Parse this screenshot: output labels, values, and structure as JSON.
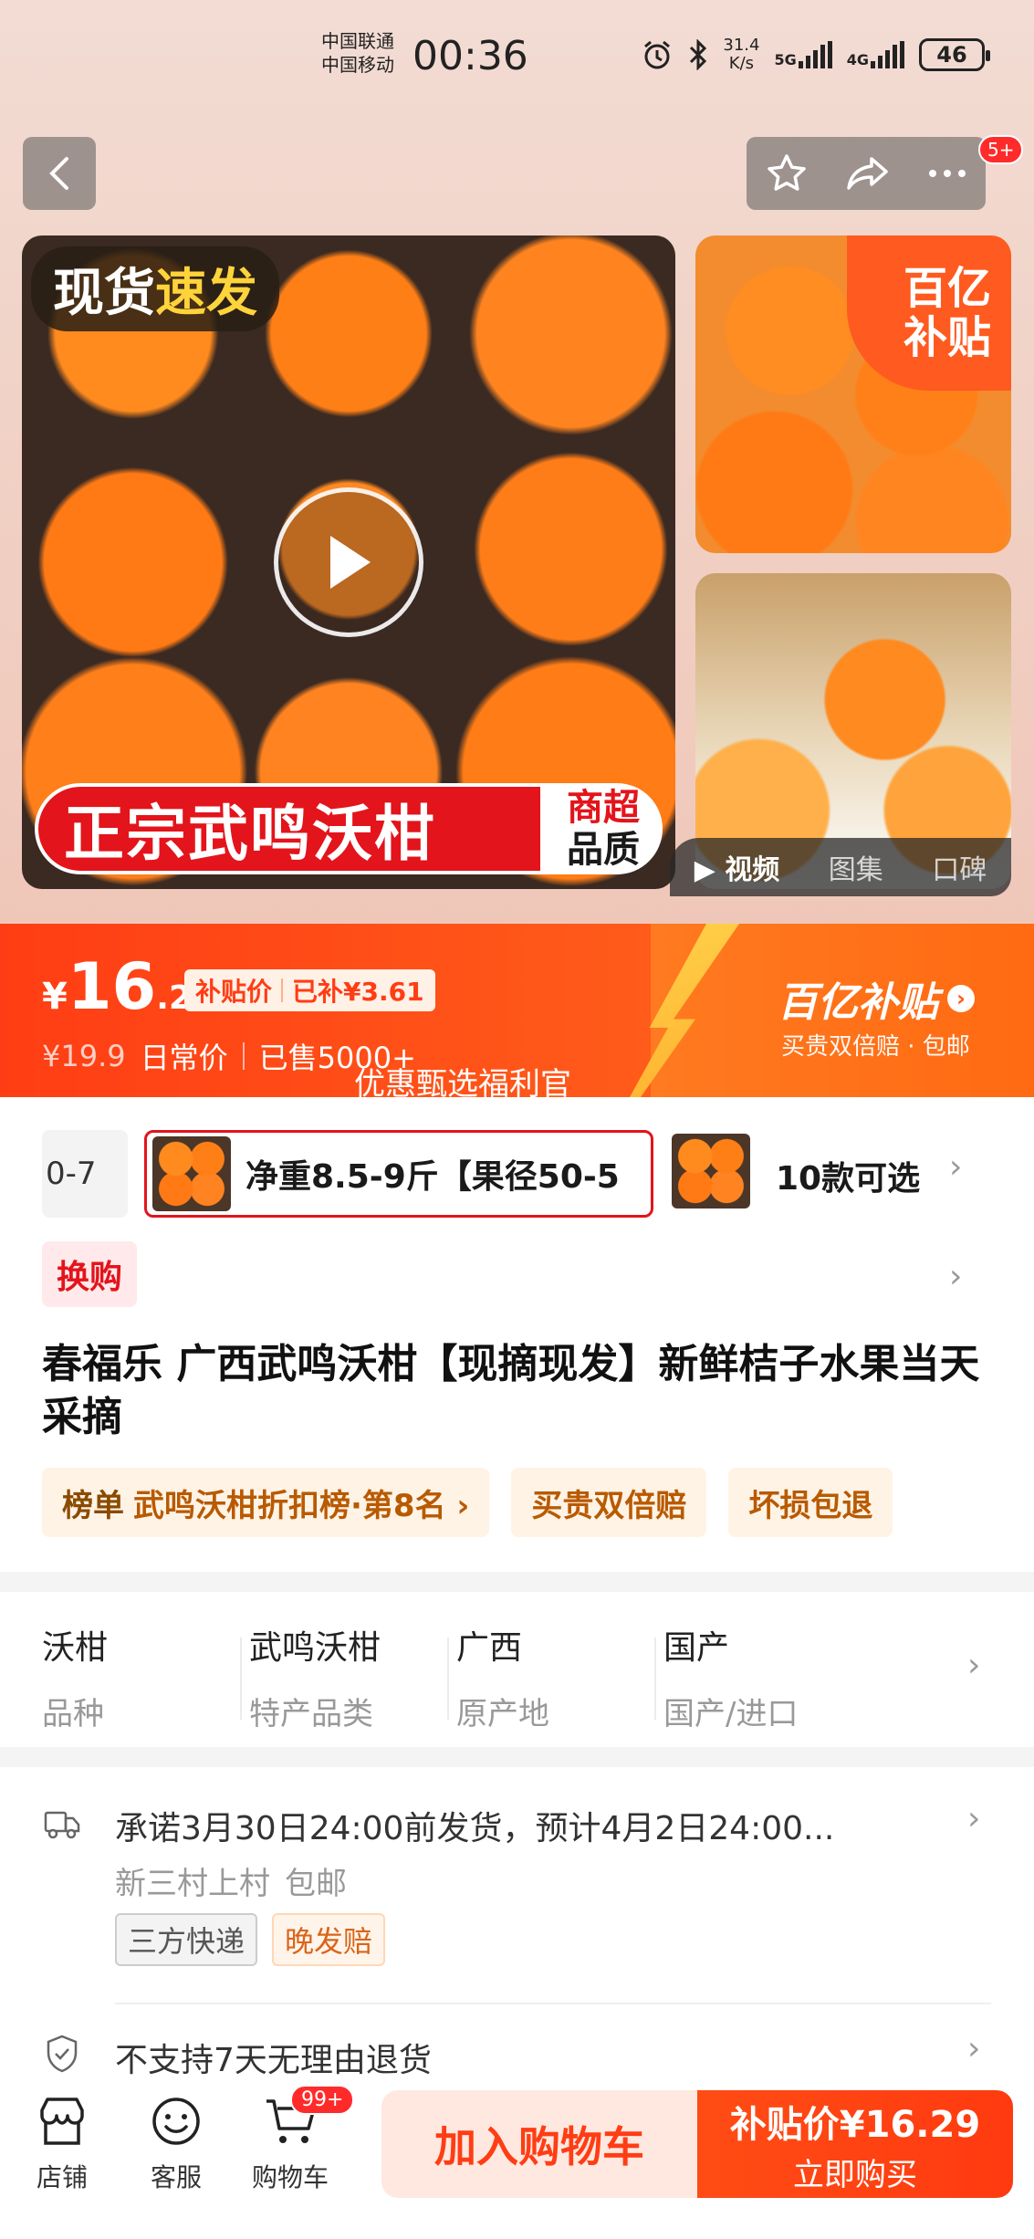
{
  "status": {
    "carrier1": "中国联通",
    "carrier2": "中国移动",
    "time": "00:36",
    "speed_value": "31.4",
    "speed_unit": "K/s",
    "net1": "5G",
    "net2": "4G",
    "battery": "46"
  },
  "nav": {
    "more_badge": "5+"
  },
  "gallery": {
    "stock_tag_a": "现货",
    "stock_tag_b": "速发",
    "banner_main": "正宗武鸣沃柑",
    "banner_side_a": "商超",
    "banner_side_b": "品质",
    "subsidy_a": "百亿",
    "subsidy_b": "补贴",
    "tabs": [
      "▶ 视频",
      "图集",
      "口碑"
    ]
  },
  "price": {
    "symbol": "¥",
    "integer": "16",
    "decimal": ".29",
    "pill_label": "补贴价",
    "pill_value": "已补¥3.61",
    "old_price": "¥19.9",
    "old_label": "日常价",
    "sold": "已售5000+",
    "promo_text": "优惠甄选福利官",
    "brand": "百亿补贴",
    "brand_sub": "买贵双倍赔 · 包邮"
  },
  "sku": {
    "prev_label": "0-7",
    "selected_label": "净重8.5-9斤【果径50-5",
    "count_label": "10款可选"
  },
  "product": {
    "swap_tag": "换购",
    "title": "春福乐 广西武鸣沃柑【现摘现发】新鲜桔子水果当天采摘",
    "tags": [
      {
        "strong": "榜单",
        "text": "武鸣沃柑折扣榜·第8名 ›"
      },
      {
        "strong": "",
        "text": "买贵双倍赔"
      },
      {
        "strong": "",
        "text": "坏损包退"
      }
    ]
  },
  "attributes": [
    {
      "value": "沃柑",
      "key": "品种"
    },
    {
      "value": "武鸣沃柑",
      "key": "特产品类"
    },
    {
      "value": "广西",
      "key": "原产地"
    },
    {
      "value": "国产",
      "key": "国产/进口"
    }
  ],
  "shipping": {
    "line1": "承诺3月30日24:00前发货，预计4月2日24:00...",
    "location": "新三村上村",
    "free_ship": "包邮",
    "tag1": "三方快递",
    "tag2": "晚发赔",
    "return_policy": "不支持7天无理由退货"
  },
  "bottom": {
    "shop": "店铺",
    "service": "客服",
    "cart": "购物车",
    "cart_badge": "99+",
    "add_cart": "加入购物车",
    "buy_price": "补贴价¥16.29",
    "buy_now": "立即购买"
  },
  "colors": {
    "accent": "#ff3d14",
    "accent_dark": "#e3141b",
    "gold": "#ffd24a"
  }
}
